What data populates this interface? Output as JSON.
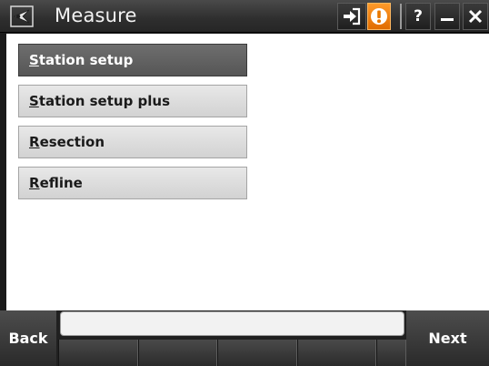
{
  "window": {
    "title": "Measure",
    "icons": [
      "app-logo-icon",
      "login-arrow-icon",
      "warning-icon",
      "help-icon",
      "minimize-icon",
      "close-icon"
    ],
    "help_label": "?"
  },
  "menu": {
    "items": [
      {
        "hotkey": "S",
        "rest": "tation setup",
        "selected": true
      },
      {
        "hotkey": "S",
        "rest": "tation setup plus",
        "selected": false
      },
      {
        "hotkey": "R",
        "rest": "esection",
        "selected": false
      },
      {
        "hotkey": "R",
        "rest": "efline",
        "selected": false
      }
    ]
  },
  "bottom": {
    "back_label": "Back",
    "next_label": "Next",
    "status_text": ""
  },
  "colors": {
    "selected_item": "#5f5f5f",
    "warning_accent": "#f08a1a",
    "content_bg": "#ffffff",
    "chrome": "#2a2a2a"
  }
}
